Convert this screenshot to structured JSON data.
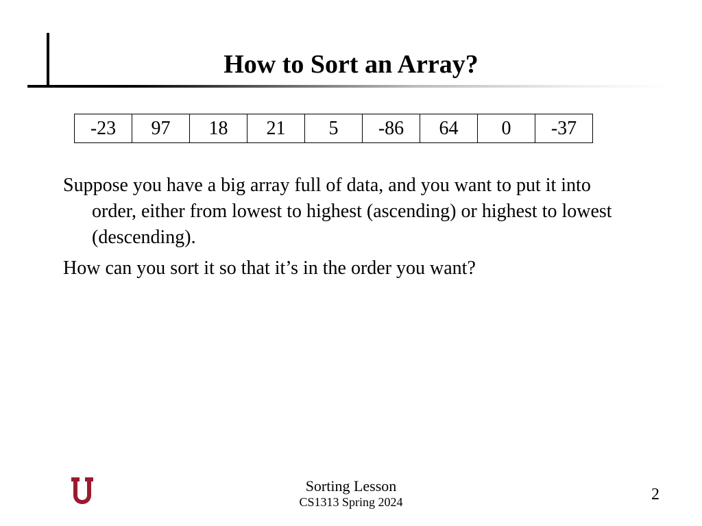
{
  "title": "How to Sort an Array?",
  "array": [
    "-23",
    "97",
    "18",
    "21",
    "5",
    "-86",
    "64",
    "0",
    "-37"
  ],
  "paragraph1": "Suppose you have a big array full of data, and you want to put it into order, either from lowest to highest (ascending) or highest to lowest (descending).",
  "paragraph2": "How can you sort it so that it’s in the order you want?",
  "footer": {
    "line1": "Sorting Lesson",
    "line2": "CS1313 Spring 2024",
    "pageNumber": "2"
  },
  "colors": {
    "logo": "#9a1b2f"
  }
}
